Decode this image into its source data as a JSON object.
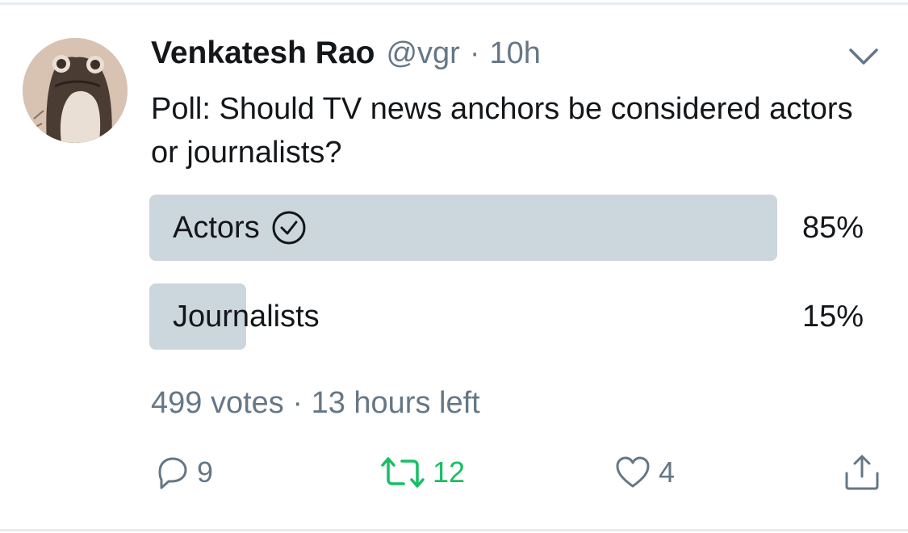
{
  "tweet": {
    "author_name": "Venkatesh Rao",
    "handle": "@vgr",
    "separator": "·",
    "time": "10h",
    "text": "Poll: Should TV news anchors be considered actors or journalists?",
    "avatar_icon": "frog-avatar",
    "menu_icon": "chevron-down-icon"
  },
  "poll": {
    "options": [
      {
        "label": "Actors",
        "percent_text": "85%",
        "percent": 85,
        "winner": true
      },
      {
        "label": "Journalists",
        "percent_text": "15%",
        "percent": 15,
        "winner": false
      }
    ],
    "votes_text": "499 votes",
    "meta_separator": "·",
    "time_left_text": "13 hours left"
  },
  "actions": {
    "reply": {
      "icon": "reply-icon",
      "count": "9"
    },
    "retweet": {
      "icon": "retweet-icon",
      "count": "12",
      "active": true,
      "color": "#17bf63"
    },
    "like": {
      "icon": "heart-icon",
      "count": "4"
    },
    "share": {
      "icon": "share-icon"
    }
  },
  "colors": {
    "text": "#14171a",
    "secondary": "#657786",
    "poll_bar": "#ccd6dd",
    "divider": "#e6ecf0"
  }
}
